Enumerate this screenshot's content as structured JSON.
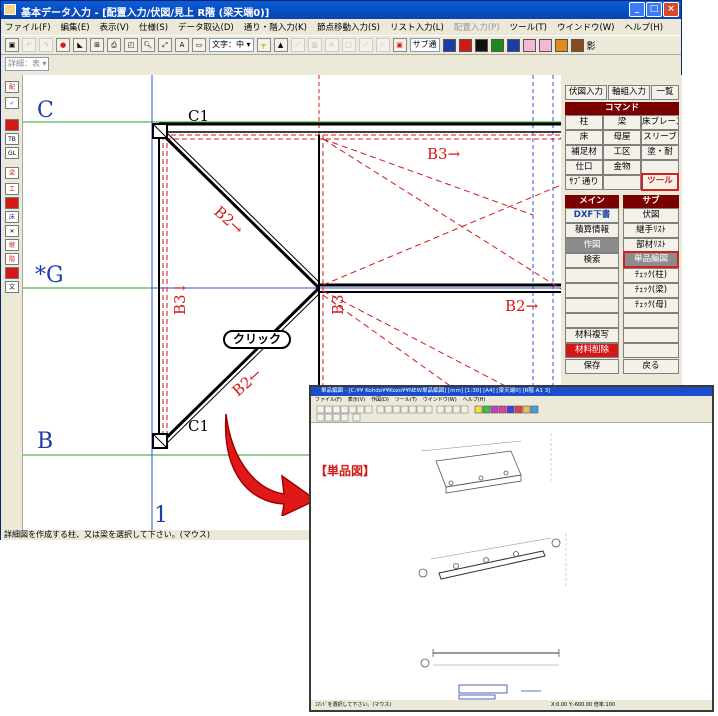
{
  "window": {
    "title": "基本データ入力 - [配置入力/伏図/見上 R階 (梁天端0)]",
    "controls": [
      "_",
      "□",
      "×"
    ]
  },
  "menu": [
    {
      "label": "ファイル(F)",
      "enabled": true
    },
    {
      "label": "編集(E)",
      "enabled": true
    },
    {
      "label": "表示(V)",
      "enabled": true
    },
    {
      "label": "仕様(S)",
      "enabled": true
    },
    {
      "label": "データ取込(D)",
      "enabled": true
    },
    {
      "label": "通り・階入力(K)",
      "enabled": true
    },
    {
      "label": "節点移動入力(S)",
      "enabled": true
    },
    {
      "label": "リスト入力(L)",
      "enabled": true
    },
    {
      "label": "配置入力(P)",
      "enabled": false
    },
    {
      "label": "ツール(T)",
      "enabled": true
    },
    {
      "label": "ウインドウ(W)",
      "enabled": true
    },
    {
      "label": "ヘルプ(H)",
      "enabled": true
    }
  ],
  "toolbar": {
    "text_size_label": "文字：中",
    "sub_label": "サブ通",
    "shadow_label": "影",
    "color_swatches": [
      "#1c3caa",
      "#d41818",
      "#111111",
      "#1c8a1c",
      "#1c3caa",
      "#f4b8d4",
      "#f4b8d4",
      "#e08c1c",
      "#8a4a1c"
    ]
  },
  "toolbar2": {
    "combo_label": "詳細：表"
  },
  "canvas": {
    "grid_labels": {
      "C": "C",
      "G": "*G",
      "B": "B",
      "one": "1"
    },
    "member_labels": {
      "c1_top": "C1",
      "c1_bottom": "C1",
      "b3_top": "B3→",
      "b2_right": "B2→",
      "b2_upper": "B2→",
      "b2_lower": "B2←",
      "b3_left": "B3↓",
      "b3_mid": "B3"
    }
  },
  "callout": {
    "text": "クリック"
  },
  "panel": {
    "top_tabs": [
      "伏図入力",
      "軸組入力",
      "一覧"
    ],
    "command_header": "コマンド",
    "command_buttons": [
      "柱",
      "梁",
      "床ブレース",
      "床",
      "母屋",
      "スリーブ",
      "補足材",
      "工区",
      "塗・耐",
      "仕口",
      "金物",
      "",
      "ｻﾌﾞ通り",
      "",
      "ツール"
    ],
    "main_header": "メイン",
    "sub_header": "サブ",
    "main_buttons": [
      "DXF下書",
      "積算情報",
      "作図",
      "検索",
      "",
      "",
      "",
      "",
      "材料複写",
      "材料削除"
    ],
    "sub_buttons": [
      "伏図",
      "継手ﾘｽﾄ",
      "部材ﾘｽﾄ",
      "単品編図",
      "ﾁｪｯｸ(柱)",
      "ﾁｪｯｸ(梁)",
      "ﾁｪｯｸ(母)",
      "",
      "",
      ""
    ],
    "save_label": "保存",
    "back_label": "戻る"
  },
  "status": {
    "text": "詳細図を作成する柱、又は梁を選択して下さい。(マウス)"
  },
  "inset": {
    "title": "単品編図 - [C:¥¥ Kohdo¥¥Kozo¥¥NEW単品編図] [mm] [1:30] [A4] [梁天端0] [R階 A1 3]",
    "menu": [
      "ファイル(F)",
      "表示(V)",
      "作図(D)",
      "ツール(T)",
      "ウインドウ(W)",
      "ヘルプ(H)"
    ],
    "label": "【単品図】",
    "status": "ｺﾏﾝﾄﾞを選択して下さい。(マウス)",
    "status_coords": "X:0.00  Y:-600.00  倍率:100"
  }
}
